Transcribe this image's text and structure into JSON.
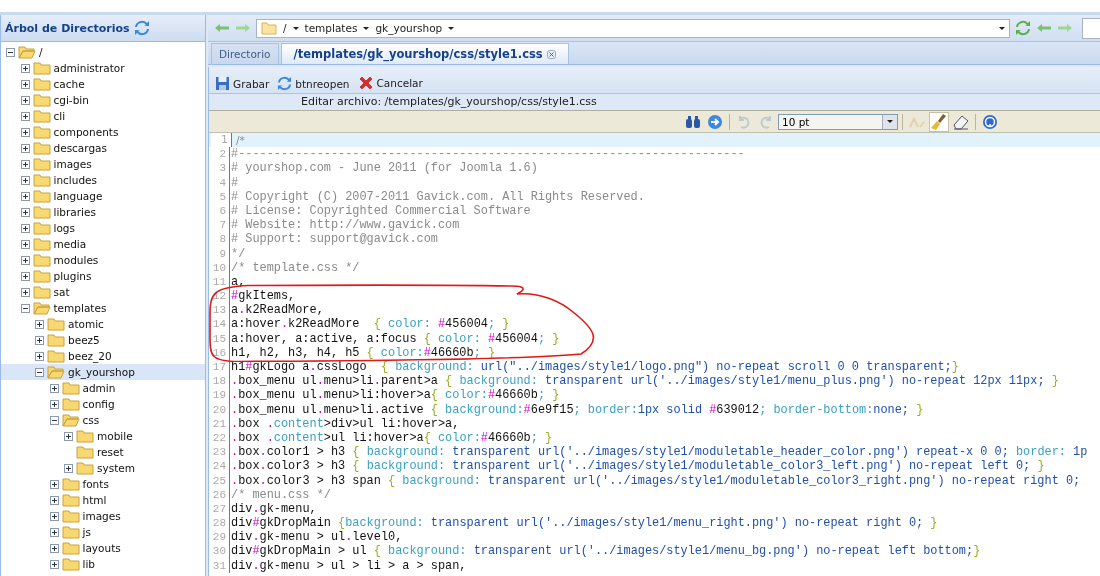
{
  "sidebar": {
    "title": "Árbol de Directorios",
    "tree": [
      {
        "label": "/",
        "expanded": true,
        "expandable": true,
        "selected": false,
        "children": [
          {
            "label": "administrator",
            "expanded": false,
            "expandable": true,
            "selected": false
          },
          {
            "label": "cache",
            "expanded": false,
            "expandable": true,
            "selected": false
          },
          {
            "label": "cgi-bin",
            "expanded": false,
            "expandable": true,
            "selected": false
          },
          {
            "label": "cli",
            "expanded": false,
            "expandable": true,
            "selected": false
          },
          {
            "label": "components",
            "expanded": false,
            "expandable": true,
            "selected": false
          },
          {
            "label": "descargas",
            "expanded": false,
            "expandable": true,
            "selected": false
          },
          {
            "label": "images",
            "expanded": false,
            "expandable": true,
            "selected": false
          },
          {
            "label": "includes",
            "expanded": false,
            "expandable": true,
            "selected": false
          },
          {
            "label": "language",
            "expanded": false,
            "expandable": true,
            "selected": false
          },
          {
            "label": "libraries",
            "expanded": false,
            "expandable": true,
            "selected": false
          },
          {
            "label": "logs",
            "expanded": false,
            "expandable": true,
            "selected": false
          },
          {
            "label": "media",
            "expanded": false,
            "expandable": true,
            "selected": false
          },
          {
            "label": "modules",
            "expanded": false,
            "expandable": true,
            "selected": false
          },
          {
            "label": "plugins",
            "expanded": false,
            "expandable": true,
            "selected": false
          },
          {
            "label": "sat",
            "expanded": false,
            "expandable": true,
            "selected": false
          },
          {
            "label": "templates",
            "expanded": true,
            "expandable": true,
            "selected": false,
            "children": [
              {
                "label": "atomic",
                "expanded": false,
                "expandable": true,
                "selected": false
              },
              {
                "label": "beez5",
                "expanded": false,
                "expandable": true,
                "selected": false
              },
              {
                "label": "beez_20",
                "expanded": false,
                "expandable": true,
                "selected": false
              },
              {
                "label": "gk_yourshop",
                "expanded": true,
                "expandable": true,
                "selected": true,
                "children": [
                  {
                    "label": "admin",
                    "expanded": false,
                    "expandable": true,
                    "selected": false
                  },
                  {
                    "label": "config",
                    "expanded": false,
                    "expandable": true,
                    "selected": false
                  },
                  {
                    "label": "css",
                    "expanded": true,
                    "expandable": true,
                    "selected": false,
                    "children": [
                      {
                        "label": "mobile",
                        "expanded": false,
                        "expandable": true,
                        "selected": false
                      },
                      {
                        "label": "reset",
                        "expanded": false,
                        "expandable": false,
                        "selected": false
                      },
                      {
                        "label": "system",
                        "expanded": false,
                        "expandable": true,
                        "selected": false
                      }
                    ]
                  },
                  {
                    "label": "fonts",
                    "expanded": false,
                    "expandable": true,
                    "selected": false
                  },
                  {
                    "label": "html",
                    "expanded": false,
                    "expandable": true,
                    "selected": false
                  },
                  {
                    "label": "images",
                    "expanded": false,
                    "expandable": true,
                    "selected": false
                  },
                  {
                    "label": "js",
                    "expanded": false,
                    "expandable": true,
                    "selected": false
                  },
                  {
                    "label": "layouts",
                    "expanded": false,
                    "expandable": true,
                    "selected": false
                  },
                  {
                    "label": "lib",
                    "expanded": false,
                    "expandable": true,
                    "selected": false
                  }
                ]
              }
            ]
          }
        ]
      }
    ]
  },
  "address_bar": {
    "crumbs": [
      "/",
      "templates",
      "gk_yourshop"
    ]
  },
  "tabs": [
    {
      "label": "Directorio",
      "selected": false,
      "closable": false
    },
    {
      "label": "/templates/gk_yourshop/css/style1.css",
      "selected": true,
      "closable": true
    }
  ],
  "actions": [
    "Grabar",
    "btnreopen",
    "Cancelar"
  ],
  "editing_label": "Editar archivo: /templates/gk_yourshop/css/style1.css",
  "editor_toolbar": {
    "font_size": "10 pt",
    "tools": [
      {
        "disabled": false,
        "selected": false
      },
      {
        "disabled": false,
        "selected": false
      },
      {
        "disabled": true,
        "selected": false
      },
      {
        "disabled": true,
        "selected": false
      },
      {
        "disabled": true,
        "selected": false
      },
      {
        "disabled": false,
        "selected": true
      },
      {
        "disabled": false,
        "selected": false
      },
      {
        "disabled": false,
        "selected": false
      }
    ]
  },
  "annotation": {
    "kind": "freehand-loop"
  },
  "code": [
    {
      "number": "1",
      "active": true,
      "tokens": [
        {
          "kind": "comment",
          "text": "/*"
        }
      ]
    },
    {
      "number": "2",
      "active": false,
      "tokens": [
        {
          "kind": "comment",
          "text": "#-----------------------------------------------------------------------"
        }
      ]
    },
    {
      "number": "3",
      "active": false,
      "tokens": [
        {
          "kind": "comment",
          "text": "# yourshop.com - June 2011 (for Joomla 1.6)"
        }
      ]
    },
    {
      "number": "4",
      "active": false,
      "tokens": [
        {
          "kind": "comment",
          "text": "#"
        }
      ]
    },
    {
      "number": "5",
      "active": false,
      "tokens": [
        {
          "kind": "comment",
          "text": "# Copyright (C) 2007-2011 Gavick.com. All Rights Reserved."
        }
      ]
    },
    {
      "number": "6",
      "active": false,
      "tokens": [
        {
          "kind": "comment",
          "text": "# License: Copyrighted Commercial Software"
        }
      ]
    },
    {
      "number": "7",
      "active": false,
      "tokens": [
        {
          "kind": "comment",
          "text": "# Website: http://www.gavick.com"
        }
      ]
    },
    {
      "number": "8",
      "active": false,
      "tokens": [
        {
          "kind": "comment",
          "text": "# Support: support@gavick.com"
        }
      ]
    },
    {
      "number": "9",
      "active": false,
      "tokens": [
        {
          "kind": "comment",
          "text": "*/"
        }
      ]
    },
    {
      "number": "10",
      "active": false,
      "tokens": [
        {
          "kind": "comment",
          "text": "/* template.css */"
        }
      ]
    },
    {
      "number": "11",
      "active": false,
      "tokens": [
        {
          "kind": "plain",
          "text": "a,"
        }
      ]
    },
    {
      "number": "12",
      "active": false,
      "tokens": [
        {
          "kind": "sigil",
          "text": "#"
        },
        {
          "kind": "plain",
          "text": "gkItems,"
        }
      ]
    },
    {
      "number": "13",
      "active": false,
      "tokens": [
        {
          "kind": "plain",
          "text": "a"
        },
        {
          "kind": "sigil",
          "text": "."
        },
        {
          "kind": "plain",
          "text": "k2ReadMore,"
        }
      ]
    },
    {
      "number": "14",
      "active": false,
      "tokens": [
        {
          "kind": "plain",
          "text": "a:hover"
        },
        {
          "kind": "sigil",
          "text": "."
        },
        {
          "kind": "plain",
          "text": "k2ReadMore  "
        },
        {
          "kind": "brace",
          "text": "{ "
        },
        {
          "kind": "property",
          "text": "color: "
        },
        {
          "kind": "sigil",
          "text": "#"
        },
        {
          "kind": "plain",
          "text": "456004"
        },
        {
          "kind": "property",
          "text": ";"
        },
        {
          "kind": "brace",
          "text": " }"
        }
      ]
    },
    {
      "number": "15",
      "active": false,
      "tokens": [
        {
          "kind": "plain",
          "text": "a:hover, a:active, a:focus "
        },
        {
          "kind": "brace",
          "text": "{ "
        },
        {
          "kind": "property",
          "text": "color: "
        },
        {
          "kind": "sigil",
          "text": "#"
        },
        {
          "kind": "plain",
          "text": "456004"
        },
        {
          "kind": "property",
          "text": ";"
        },
        {
          "kind": "brace",
          "text": " }"
        }
      ]
    },
    {
      "number": "16",
      "active": false,
      "tokens": [
        {
          "kind": "plain",
          "text": "h1, h2, h3, h4, h5 "
        },
        {
          "kind": "brace",
          "text": "{ "
        },
        {
          "kind": "property",
          "text": "color:"
        },
        {
          "kind": "sigil",
          "text": "#"
        },
        {
          "kind": "plain",
          "text": "46660b"
        },
        {
          "kind": "property",
          "text": ";"
        },
        {
          "kind": "brace",
          "text": " }"
        }
      ]
    },
    {
      "number": "17",
      "active": false,
      "tokens": [
        {
          "kind": "plain",
          "text": "h1"
        },
        {
          "kind": "sigil",
          "text": "#"
        },
        {
          "kind": "plain",
          "text": "gkLogo a"
        },
        {
          "kind": "sigil",
          "text": "."
        },
        {
          "kind": "plain",
          "text": "cssLogo  "
        },
        {
          "kind": "brace",
          "text": "{ "
        },
        {
          "kind": "property",
          "text": "background: "
        },
        {
          "kind": "value",
          "text": "url(\"../images/style1/logo.png\") no-repeat scroll 0 0 transparent;"
        },
        {
          "kind": "brace",
          "text": "}"
        }
      ]
    },
    {
      "number": "18",
      "active": false,
      "tokens": [
        {
          "kind": "sigil",
          "text": "."
        },
        {
          "kind": "plain",
          "text": "box_menu ul"
        },
        {
          "kind": "sigil",
          "text": "."
        },
        {
          "kind": "plain",
          "text": "menu>li"
        },
        {
          "kind": "sigil",
          "text": "."
        },
        {
          "kind": "plain",
          "text": "parent>a "
        },
        {
          "kind": "brace",
          "text": "{ "
        },
        {
          "kind": "property",
          "text": "background: "
        },
        {
          "kind": "value",
          "text": "transparent url('../images/style1/menu_plus.png') no-repeat 12px 11px;"
        },
        {
          "kind": "brace",
          "text": " }"
        }
      ]
    },
    {
      "number": "19",
      "active": false,
      "tokens": [
        {
          "kind": "sigil",
          "text": "."
        },
        {
          "kind": "plain",
          "text": "box_menu ul"
        },
        {
          "kind": "sigil",
          "text": "."
        },
        {
          "kind": "plain",
          "text": "menu>li:hover>a"
        },
        {
          "kind": "brace",
          "text": "{ "
        },
        {
          "kind": "property",
          "text": "color:"
        },
        {
          "kind": "sigil",
          "text": "#"
        },
        {
          "kind": "plain",
          "text": "46660b"
        },
        {
          "kind": "property",
          "text": ";"
        },
        {
          "kind": "brace",
          "text": " }"
        }
      ]
    },
    {
      "number": "20",
      "active": false,
      "tokens": [
        {
          "kind": "sigil",
          "text": "."
        },
        {
          "kind": "plain",
          "text": "box_menu ul"
        },
        {
          "kind": "sigil",
          "text": "."
        },
        {
          "kind": "plain",
          "text": "menu>li"
        },
        {
          "kind": "sigil",
          "text": "."
        },
        {
          "kind": "plain",
          "text": "active "
        },
        {
          "kind": "brace",
          "text": "{ "
        },
        {
          "kind": "property",
          "text": "background:"
        },
        {
          "kind": "sigil",
          "text": "#"
        },
        {
          "kind": "plain",
          "text": "6e9f15"
        },
        {
          "kind": "property",
          "text": "; border:"
        },
        {
          "kind": "value",
          "text": "1px solid "
        },
        {
          "kind": "sigil",
          "text": "#"
        },
        {
          "kind": "plain",
          "text": "639012"
        },
        {
          "kind": "property",
          "text": "; border-bottom:"
        },
        {
          "kind": "value",
          "text": "none;"
        },
        {
          "kind": "brace",
          "text": " }"
        }
      ]
    },
    {
      "number": "21",
      "active": false,
      "tokens": [
        {
          "kind": "sigil",
          "text": "."
        },
        {
          "kind": "plain",
          "text": "box "
        },
        {
          "kind": "sigil",
          "text": "."
        },
        {
          "kind": "property",
          "text": "content"
        },
        {
          "kind": "plain",
          "text": ">div>ul li:hover>a,"
        }
      ]
    },
    {
      "number": "22",
      "active": false,
      "tokens": [
        {
          "kind": "sigil",
          "text": "."
        },
        {
          "kind": "plain",
          "text": "box "
        },
        {
          "kind": "sigil",
          "text": "."
        },
        {
          "kind": "property",
          "text": "content"
        },
        {
          "kind": "plain",
          "text": ">ul li:hover>a"
        },
        {
          "kind": "brace",
          "text": "{ "
        },
        {
          "kind": "property",
          "text": "color:"
        },
        {
          "kind": "sigil",
          "text": "#"
        },
        {
          "kind": "plain",
          "text": "46660b"
        },
        {
          "kind": "property",
          "text": ";"
        },
        {
          "kind": "brace",
          "text": " }"
        }
      ]
    },
    {
      "number": "23",
      "active": false,
      "tokens": [
        {
          "kind": "sigil",
          "text": "."
        },
        {
          "kind": "plain",
          "text": "box"
        },
        {
          "kind": "sigil",
          "text": "."
        },
        {
          "kind": "plain",
          "text": "color1 > h3 "
        },
        {
          "kind": "brace",
          "text": "{ "
        },
        {
          "kind": "property",
          "text": "background: "
        },
        {
          "kind": "value",
          "text": "transparent url('../images/style1/moduletable_header_color.png') repeat-x 0 0; "
        },
        {
          "kind": "property",
          "text": "border: "
        },
        {
          "kind": "value",
          "text": "1p"
        }
      ]
    },
    {
      "number": "24",
      "active": false,
      "tokens": [
        {
          "kind": "sigil",
          "text": "."
        },
        {
          "kind": "plain",
          "text": "box"
        },
        {
          "kind": "sigil",
          "text": "."
        },
        {
          "kind": "plain",
          "text": "color3 > h3 "
        },
        {
          "kind": "brace",
          "text": "{ "
        },
        {
          "kind": "property",
          "text": "background: "
        },
        {
          "kind": "value",
          "text": "transparent url('../images/style1/moduletable_color3_left.png') no-repeat left 0;"
        },
        {
          "kind": "brace",
          "text": " }"
        }
      ]
    },
    {
      "number": "25",
      "active": false,
      "tokens": [
        {
          "kind": "sigil",
          "text": "."
        },
        {
          "kind": "plain",
          "text": "box"
        },
        {
          "kind": "sigil",
          "text": "."
        },
        {
          "kind": "plain",
          "text": "color3 > h3 span "
        },
        {
          "kind": "brace",
          "text": "{ "
        },
        {
          "kind": "property",
          "text": "background: "
        },
        {
          "kind": "value",
          "text": "transparent url('../images/style1/moduletable_color3_right.png') no-repeat right 0;"
        }
      ]
    },
    {
      "number": "26",
      "active": false,
      "tokens": [
        {
          "kind": "comment",
          "text": "/* menu.css */"
        }
      ]
    },
    {
      "number": "27",
      "active": false,
      "tokens": [
        {
          "kind": "plain",
          "text": "div"
        },
        {
          "kind": "sigil",
          "text": "."
        },
        {
          "kind": "plain",
          "text": "gk-menu,"
        }
      ]
    },
    {
      "number": "28",
      "active": false,
      "tokens": [
        {
          "kind": "plain",
          "text": "div"
        },
        {
          "kind": "sigil",
          "text": "#"
        },
        {
          "kind": "plain",
          "text": "gkDropMain "
        },
        {
          "kind": "brace",
          "text": "{"
        },
        {
          "kind": "property",
          "text": "background: "
        },
        {
          "kind": "value",
          "text": "transparent url('../images/style1/menu_right.png') no-repeat right 0;"
        },
        {
          "kind": "brace",
          "text": " }"
        }
      ]
    },
    {
      "number": "29",
      "active": false,
      "tokens": [
        {
          "kind": "plain",
          "text": "div"
        },
        {
          "kind": "sigil",
          "text": "."
        },
        {
          "kind": "plain",
          "text": "gk-menu > ul"
        },
        {
          "kind": "sigil",
          "text": "."
        },
        {
          "kind": "plain",
          "text": "level0,"
        }
      ]
    },
    {
      "number": "30",
      "active": false,
      "tokens": [
        {
          "kind": "plain",
          "text": "div"
        },
        {
          "kind": "sigil",
          "text": "#"
        },
        {
          "kind": "plain",
          "text": "gkDropMain > ul "
        },
        {
          "kind": "brace",
          "text": "{ "
        },
        {
          "kind": "property",
          "text": "background: "
        },
        {
          "kind": "value",
          "text": "transparent url('../images/style1/menu_bg.png') no-repeat left bottom;"
        },
        {
          "kind": "brace",
          "text": "}"
        }
      ]
    },
    {
      "number": "31",
      "active": false,
      "tokens": [
        {
          "kind": "plain",
          "text": "div"
        },
        {
          "kind": "sigil",
          "text": "."
        },
        {
          "kind": "plain",
          "text": "gk-menu > ul > li > a > span,"
        }
      ]
    }
  ]
}
